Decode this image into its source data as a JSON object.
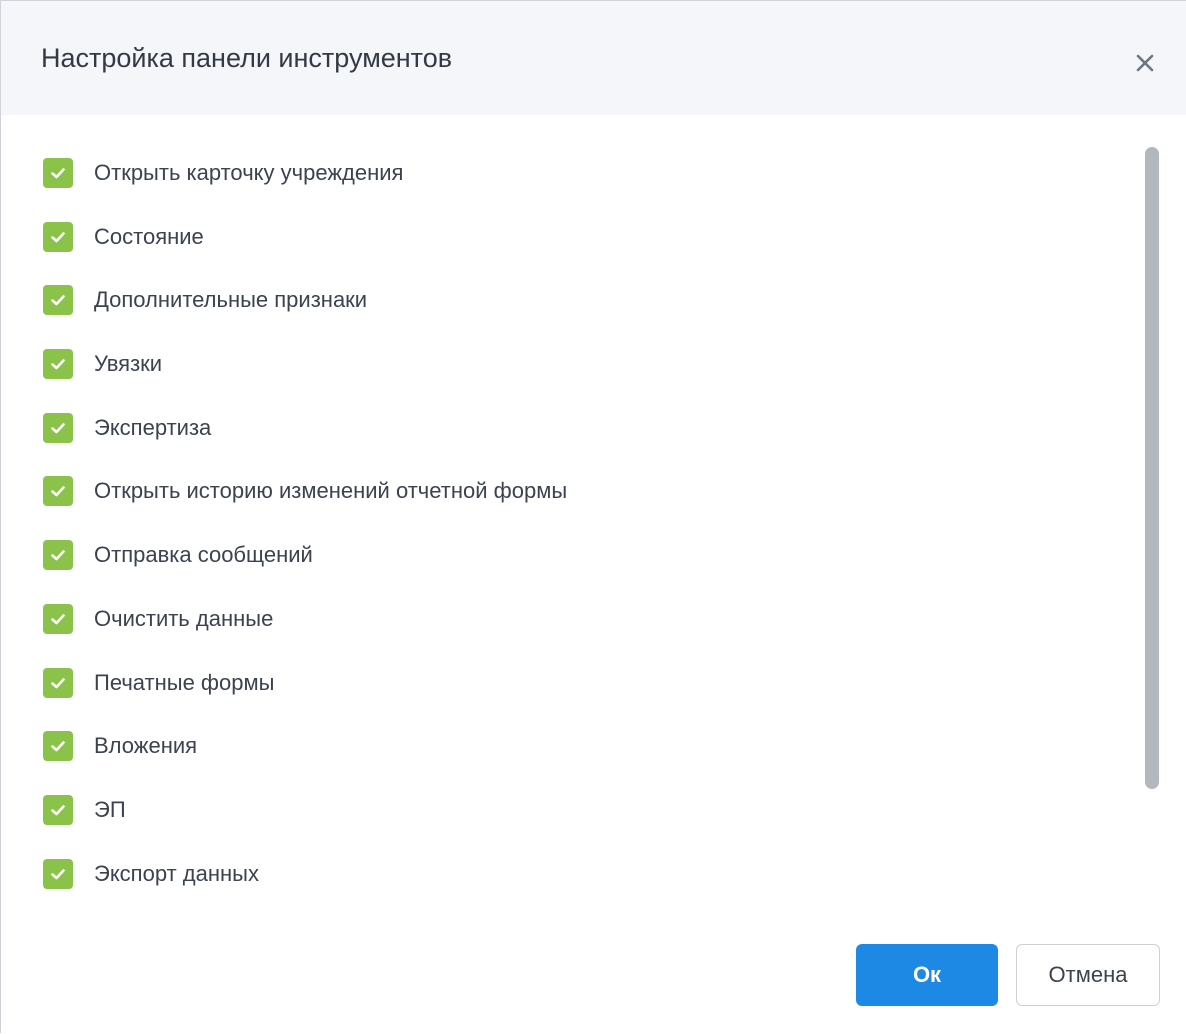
{
  "dialog": {
    "title": "Настройка панели инструментов",
    "close_icon": "close-icon"
  },
  "options": [
    {
      "label": "Открыть карточку учреждения",
      "checked": true
    },
    {
      "label": "Состояние",
      "checked": true
    },
    {
      "label": "Дополнительные признаки",
      "checked": true
    },
    {
      "label": "Увязки",
      "checked": true
    },
    {
      "label": "Экспертиза",
      "checked": true
    },
    {
      "label": "Открыть историю изменений отчетной формы",
      "checked": true
    },
    {
      "label": "Отправка сообщений",
      "checked": true
    },
    {
      "label": "Очистить данные",
      "checked": true
    },
    {
      "label": "Печатные формы",
      "checked": true
    },
    {
      "label": "Вложения",
      "checked": true
    },
    {
      "label": "ЭП",
      "checked": true
    },
    {
      "label": "Экспорт данных",
      "checked": true
    }
  ],
  "footer": {
    "ok_label": "Ок",
    "cancel_label": "Отмена"
  },
  "colors": {
    "checkbox": "#8bc34a",
    "primary_button": "#1e88e5",
    "header_background": "#f4f6f9"
  }
}
